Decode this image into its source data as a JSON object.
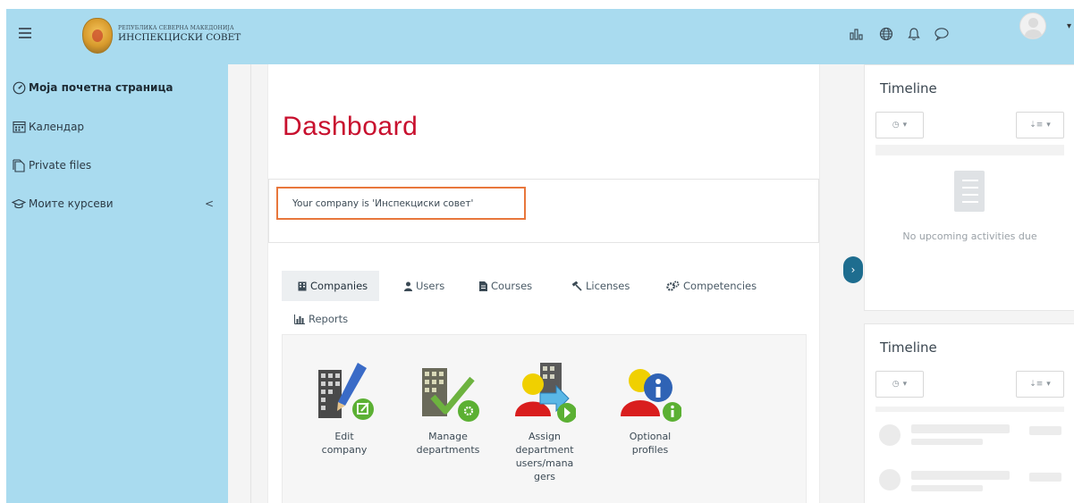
{
  "header": {
    "logo_small": "РЕПУБЛИКА СЕВЕРНА МАКЕДОНИЈА",
    "logo_big": "ИНСПЕКЦИСКИ СОВЕТ",
    "icons": [
      "menu-icon",
      "reports-icon",
      "language-icon",
      "notifications-icon",
      "messages-icon",
      "user-avatar"
    ]
  },
  "sidebar": {
    "items": [
      {
        "label": "Моја почетна страница",
        "icon": "dashboard-icon",
        "active": true
      },
      {
        "label": "Календар",
        "icon": "calendar-icon",
        "active": false
      },
      {
        "label": "Private files",
        "icon": "files-icon",
        "active": false
      },
      {
        "label": "Моите курсеви",
        "icon": "courses-icon",
        "active": false
      }
    ]
  },
  "main": {
    "title": "Dashboard",
    "company_notice": "Your company is 'Инспекциски совет'",
    "tabs": [
      {
        "label": "Companies",
        "icon": "building-icon",
        "active": true
      },
      {
        "label": "Users",
        "icon": "user-icon",
        "active": false
      },
      {
        "label": "Courses",
        "icon": "file-icon",
        "active": false
      },
      {
        "label": "Licenses",
        "icon": "gavel-icon",
        "active": false
      },
      {
        "label": "Competencies",
        "icon": "cogs-icon",
        "active": false
      },
      {
        "label": "Reports",
        "icon": "bar-chart-icon",
        "active": false
      }
    ],
    "actions": [
      {
        "caption": "Edit company",
        "lines": [
          "Edit",
          "company"
        ]
      },
      {
        "caption": "Manage departments",
        "lines": [
          "Manage",
          "departments"
        ]
      },
      {
        "caption": "Assign department users/managers",
        "lines": [
          "Assign",
          "department",
          "users/mana",
          "gers"
        ]
      },
      {
        "caption": "Optional profiles",
        "lines": [
          "Optional",
          "profiles"
        ]
      }
    ]
  },
  "right": {
    "timeline1": {
      "title": "Timeline",
      "empty_text": "No upcoming activities due"
    },
    "timeline2": {
      "title": "Timeline"
    }
  },
  "colors": {
    "navbar": "#a9dbef",
    "title_red": "#c8102e",
    "notice_border": "#e8773c",
    "drawer_toggle": "#1e6d8f"
  }
}
